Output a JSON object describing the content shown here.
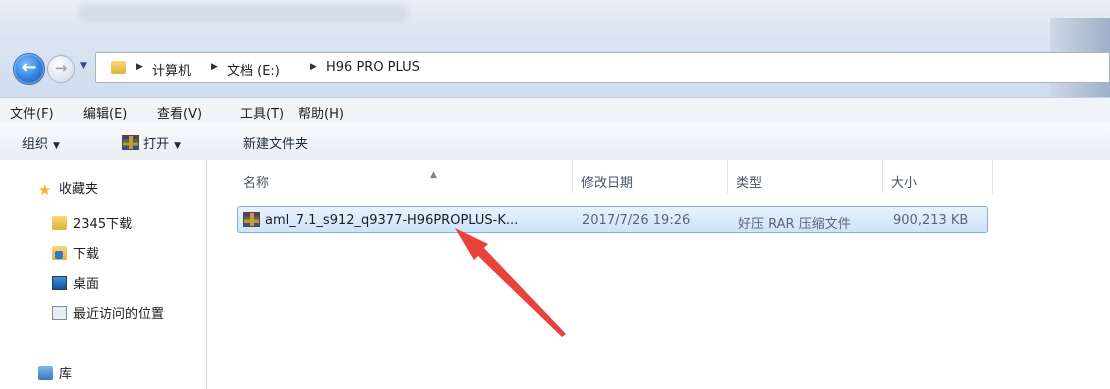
{
  "address_bar": {
    "crumbs": [
      "计算机",
      "文档 (E:)",
      "H96 PRO PLUS"
    ]
  },
  "menubar": {
    "items": [
      "文件(F)",
      "编辑(E)",
      "查看(V)",
      "工具(T)",
      "帮助(H)"
    ]
  },
  "toolbar": {
    "organize": "组织",
    "open": "打开",
    "new_folder": "新建文件夹"
  },
  "nav_pane": {
    "favorites": "收藏夹",
    "items": [
      "2345下载",
      "下载",
      "桌面",
      "最近访问的位置"
    ],
    "library": "库"
  },
  "file_list": {
    "columns": [
      "名称",
      "修改日期",
      "类型",
      "大小"
    ],
    "rows": [
      {
        "name": "aml_7.1_s912_q9377-H96PROPLUS-K...",
        "date": "2017/7/26 19:26",
        "type": "好压 RAR 压缩文件",
        "size": "900,213 KB"
      }
    ]
  },
  "icons": {
    "back": "back-arrow-icon",
    "forward": "forward-arrow-icon",
    "favorites": "star-icon",
    "archive": "rar-archive-icon"
  },
  "colors": {
    "annotation_arrow": "#e8423a",
    "selection": "#cde3fb"
  }
}
